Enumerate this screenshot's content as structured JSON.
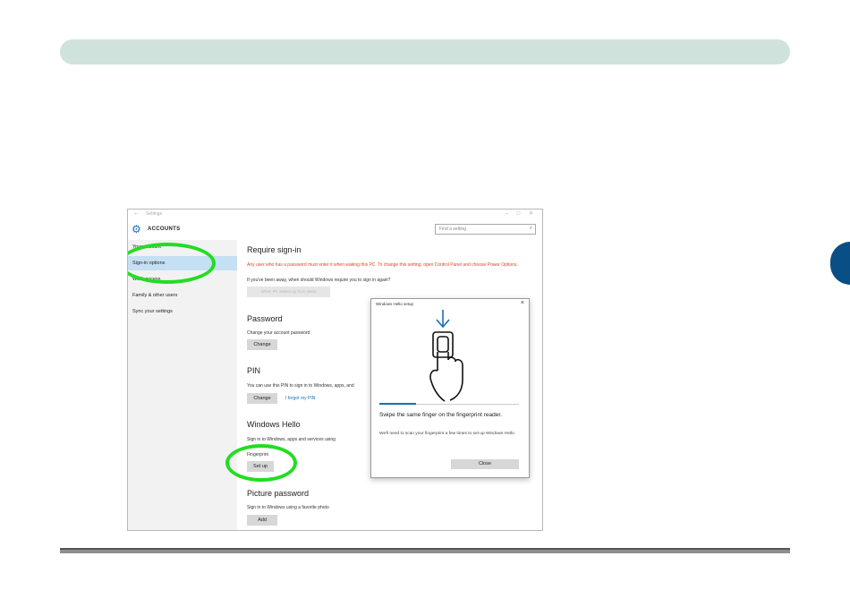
{
  "window": {
    "title": "Settings",
    "controls": "–  □  ✕"
  },
  "header": {
    "title": "ACCOUNTS",
    "search_placeholder": "Find a setting"
  },
  "sidebar": {
    "items": [
      {
        "label": "Your account"
      },
      {
        "label": "Sign-in options"
      },
      {
        "label": "Work access"
      },
      {
        "label": "Family & other users"
      },
      {
        "label": "Sync your settings"
      }
    ]
  },
  "main": {
    "require": {
      "heading": "Require sign-in",
      "warning": "Any user who has a password must enter it when waking this PC. To change this setting, open Control Panel and choose Power Options.",
      "question": "If you've been away, when should Windows require you to sign in again?",
      "dropdown_value": "When PC wakes up from sleep"
    },
    "password": {
      "heading": "Password",
      "desc": "Change your account password",
      "button": "Change"
    },
    "pin": {
      "heading": "PIN",
      "desc": "You can use this PIN to sign in to Windows, apps, and",
      "button": "Change",
      "link": "I forgot my PIN"
    },
    "hello": {
      "heading": "Windows Hello",
      "desc": "Sign in to Windows, apps and services using",
      "fingerprint_label": "Fingerprint",
      "button": "Set up"
    },
    "picture": {
      "heading": "Picture password",
      "desc": "Sign in to Windows using a favorite photo",
      "button": "Add"
    }
  },
  "dialog": {
    "title": "Windows Hello setup",
    "message": "Swipe the same finger on the fingerprint reader.",
    "sub": "We'll need to scan your fingerprint a few times to set up Windows Hello.",
    "button": "Close",
    "progress": 0.26,
    "accent": "#1a6fb3"
  },
  "colors": {
    "highlight": "#22dd22",
    "chapter_tab": "#0a4e86",
    "header_bar": "#cfe3dc"
  }
}
